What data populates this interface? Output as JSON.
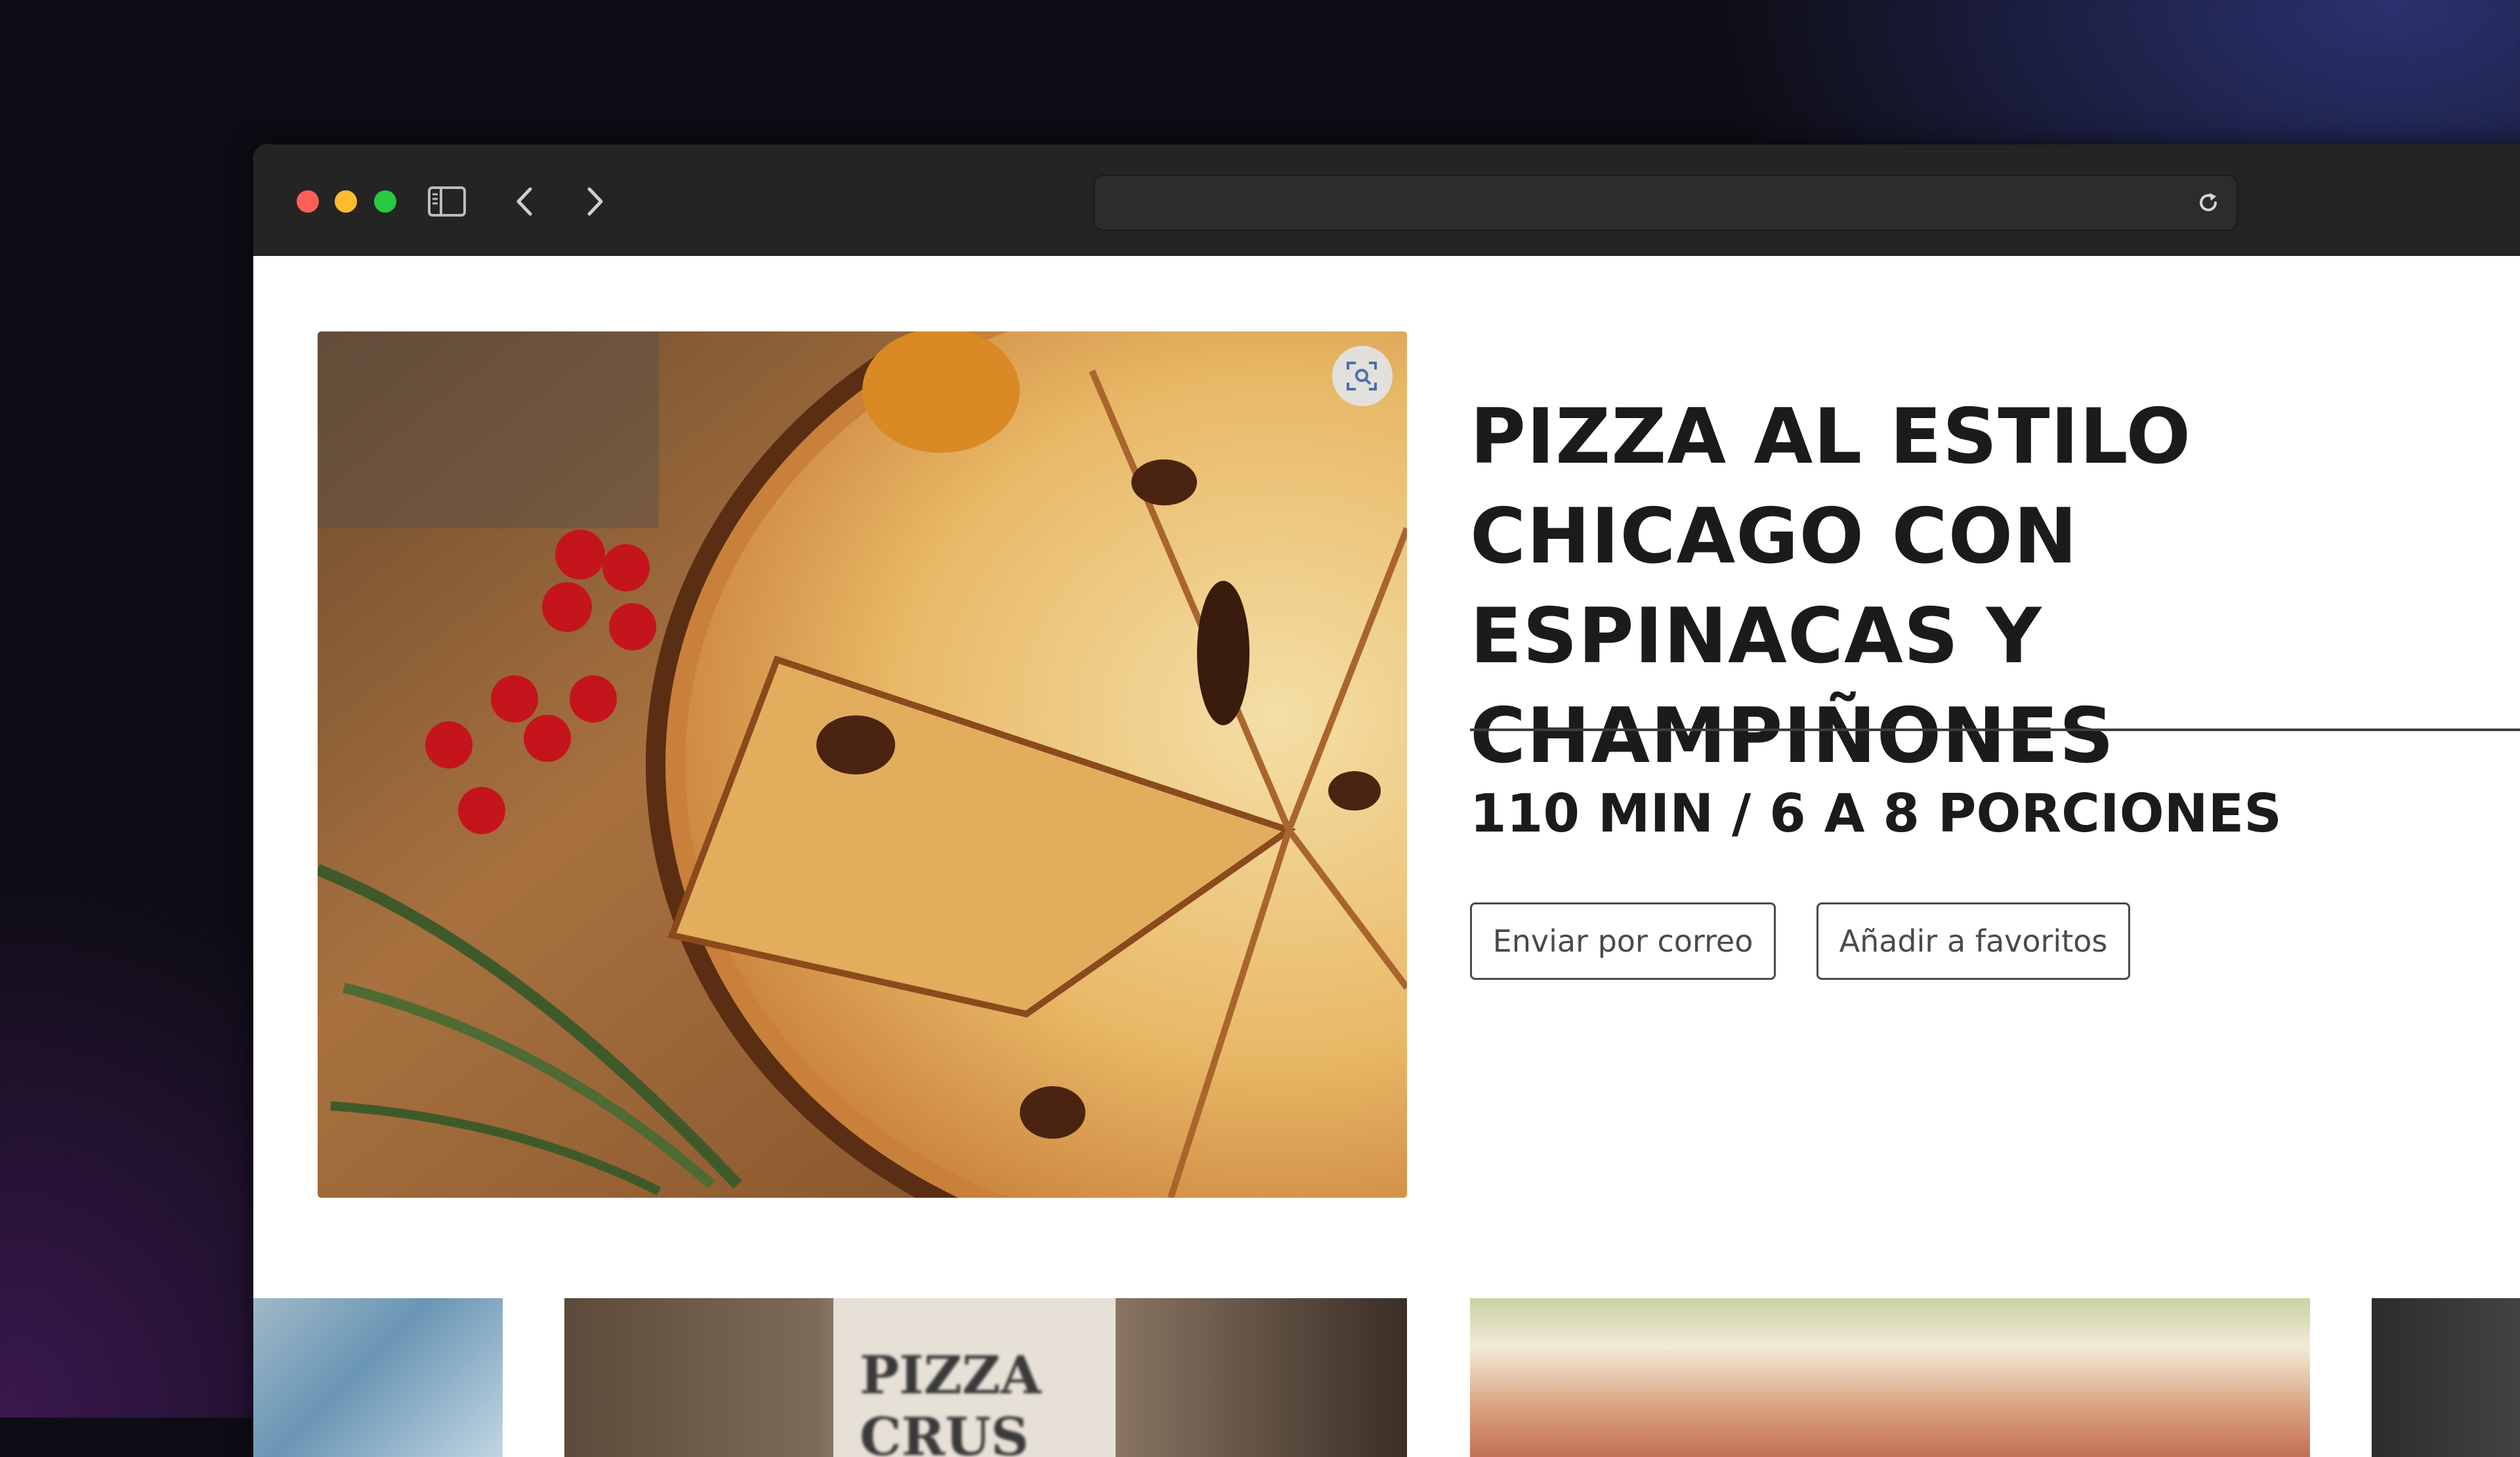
{
  "browser": {
    "url": "",
    "icons": {
      "sidebar": "sidebar-toggle-icon",
      "back": "chevron-left-icon",
      "forward": "chevron-right-icon",
      "reload": "reload-icon"
    }
  },
  "recipe": {
    "title": "PIZZA AL ESTILO CHICAGO CON ESPINACAS Y CHAMPIÑONES",
    "meta": "110 MIN / 6 A 8 PORCIONES",
    "actions": {
      "email": "Enviar por correo",
      "favorite": "Añadir a favoritos"
    }
  },
  "related_thumbnails": [
    {
      "kind": "dishes-photo"
    },
    {
      "kind": "pizza-crust-mix-photo",
      "package_text": "PIZZA CRUS"
    },
    {
      "kind": "pizza-slice-photo"
    },
    {
      "kind": "dark-photo"
    }
  ],
  "colors": {
    "desktop": "#0e0d15",
    "toolbar": "#242424",
    "text": "#1b1b1b",
    "button_border": "#4a4a4a"
  }
}
